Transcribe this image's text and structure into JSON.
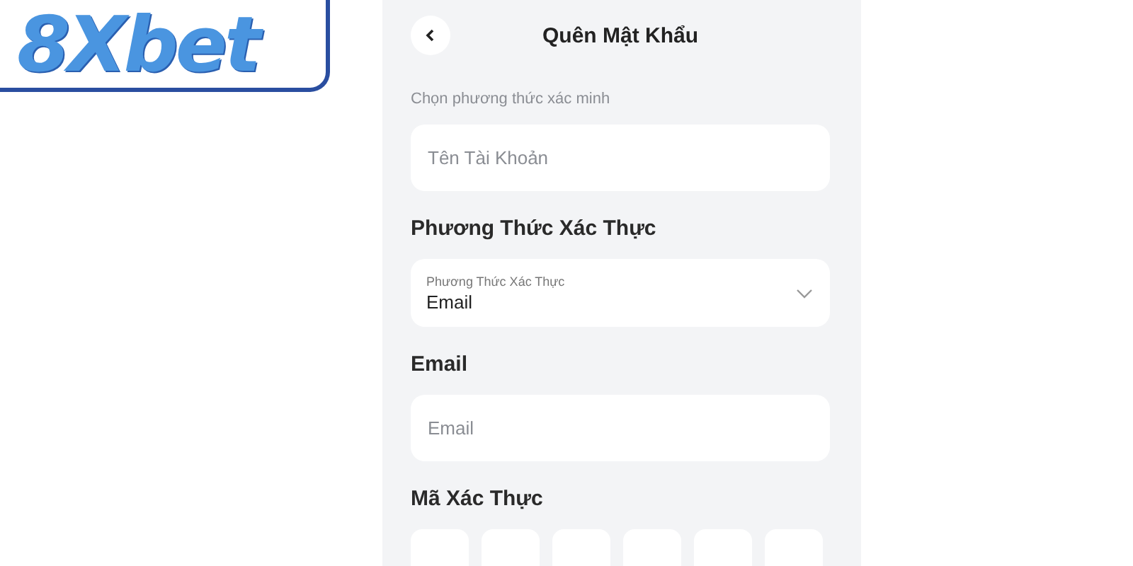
{
  "logo": {
    "text": "8Xbet"
  },
  "header": {
    "title": "Quên Mật Khẩu"
  },
  "form": {
    "hint": "Chọn phương thức xác minh",
    "account_field": {
      "placeholder": "Tên Tài Khoản"
    },
    "method_heading": "Phương Thức Xác Thực",
    "method_select": {
      "label": "Phương Thức Xác Thực",
      "value": "Email"
    },
    "email_heading": "Email",
    "email_field": {
      "placeholder": "Email"
    },
    "code_heading": "Mã Xác Thực",
    "code_boxes": [
      {
        "kind": "digit"
      },
      {
        "kind": "digit"
      },
      {
        "kind": "digit"
      },
      {
        "kind": "digit"
      },
      {
        "kind": "digit"
      },
      {
        "kind": "digit"
      }
    ]
  }
}
